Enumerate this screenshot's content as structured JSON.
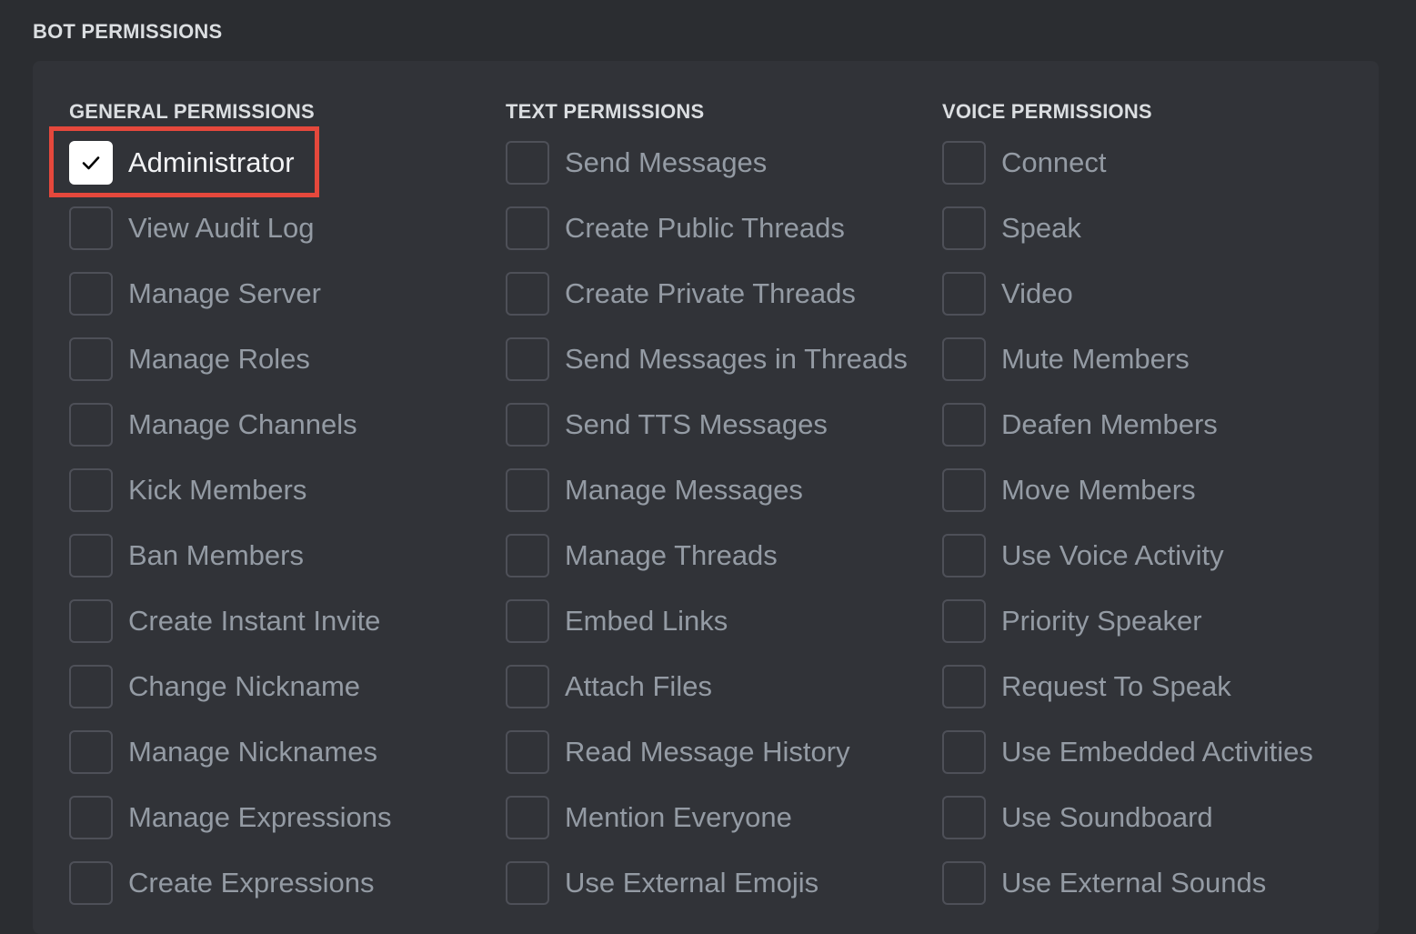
{
  "title": "BOT PERMISSIONS",
  "columns": [
    {
      "heading": "GENERAL PERMISSIONS",
      "permissions": [
        {
          "label": "Administrator",
          "checked": true
        },
        {
          "label": "View Audit Log",
          "checked": false
        },
        {
          "label": "Manage Server",
          "checked": false
        },
        {
          "label": "Manage Roles",
          "checked": false
        },
        {
          "label": "Manage Channels",
          "checked": false
        },
        {
          "label": "Kick Members",
          "checked": false
        },
        {
          "label": "Ban Members",
          "checked": false
        },
        {
          "label": "Create Instant Invite",
          "checked": false
        },
        {
          "label": "Change Nickname",
          "checked": false
        },
        {
          "label": "Manage Nicknames",
          "checked": false
        },
        {
          "label": "Manage Expressions",
          "checked": false
        },
        {
          "label": "Create Expressions",
          "checked": false
        }
      ]
    },
    {
      "heading": "TEXT PERMISSIONS",
      "permissions": [
        {
          "label": "Send Messages",
          "checked": false
        },
        {
          "label": "Create Public Threads",
          "checked": false
        },
        {
          "label": "Create Private Threads",
          "checked": false
        },
        {
          "label": "Send Messages in Threads",
          "checked": false
        },
        {
          "label": "Send TTS Messages",
          "checked": false
        },
        {
          "label": "Manage Messages",
          "checked": false
        },
        {
          "label": "Manage Threads",
          "checked": false
        },
        {
          "label": "Embed Links",
          "checked": false
        },
        {
          "label": "Attach Files",
          "checked": false
        },
        {
          "label": "Read Message History",
          "checked": false
        },
        {
          "label": "Mention Everyone",
          "checked": false
        },
        {
          "label": "Use External Emojis",
          "checked": false
        }
      ]
    },
    {
      "heading": "VOICE PERMISSIONS",
      "permissions": [
        {
          "label": "Connect",
          "checked": false
        },
        {
          "label": "Speak",
          "checked": false
        },
        {
          "label": "Video",
          "checked": false
        },
        {
          "label": "Mute Members",
          "checked": false
        },
        {
          "label": "Deafen Members",
          "checked": false
        },
        {
          "label": "Move Members",
          "checked": false
        },
        {
          "label": "Use Voice Activity",
          "checked": false
        },
        {
          "label": "Priority Speaker",
          "checked": false
        },
        {
          "label": "Request To Speak",
          "checked": false
        },
        {
          "label": "Use Embedded Activities",
          "checked": false
        },
        {
          "label": "Use Soundboard",
          "checked": false
        },
        {
          "label": "Use External Sounds",
          "checked": false
        }
      ]
    }
  ],
  "colors": {
    "background": "#2b2d31",
    "panel": "#313338",
    "heading_text": "#dbdee1",
    "label_text": "#949ba4",
    "checkbox_border": "#4e5058",
    "highlight": "#e5483c"
  },
  "icons": {
    "checked": "check-icon"
  }
}
